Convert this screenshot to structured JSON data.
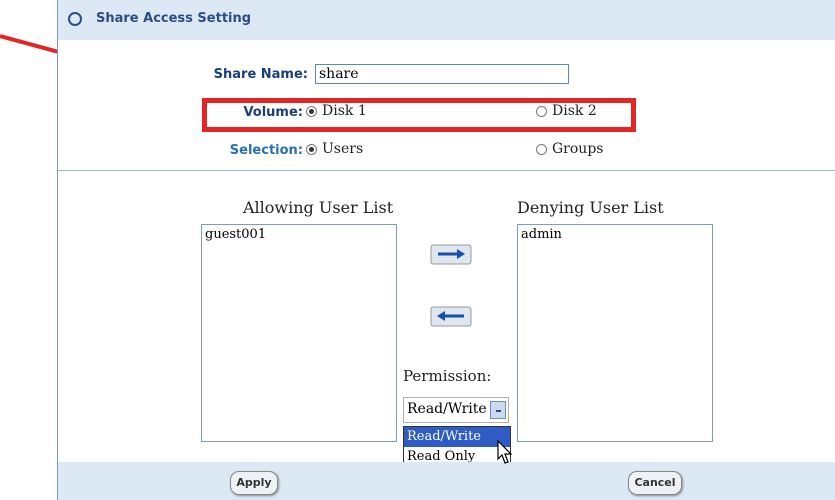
{
  "header": {
    "title": "Share Access Setting",
    "icon": "gear-icon"
  },
  "form": {
    "share_name_label": "Share Name:",
    "share_name_value": "share",
    "volume_label": "Volume:",
    "volume_options": [
      "Disk 1",
      "Disk 2"
    ],
    "volume_selected": "Disk 1",
    "selection_label": "Selection:",
    "selection_options": [
      "Users",
      "Groups"
    ],
    "selection_selected": "Users"
  },
  "lists": {
    "allowing_title": "Allowing User List",
    "allowing_items": [
      "guest001"
    ],
    "denying_title": "Denying User List",
    "denying_items": [
      "admin"
    ]
  },
  "permission": {
    "label": "Permission:",
    "selected": "Read/Write",
    "options": [
      "Read/Write",
      "Read Only"
    ]
  },
  "footer": {
    "apply_label": "Apply",
    "cancel_label": "Cancel"
  },
  "colors": {
    "panel_bg": "#dce8f4",
    "label_blue": "#1a3e78",
    "highlight": "#e52424",
    "option_selected": "#2f5cc4"
  }
}
